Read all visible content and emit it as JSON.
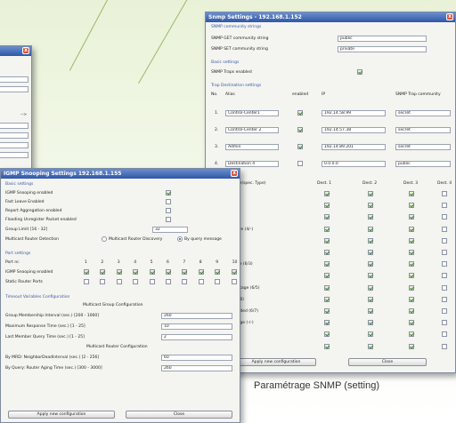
{
  "snmp": {
    "title": "Snmp Settings - 192.168.1.152",
    "community_section": "SNMP community strings",
    "get_label": "SNMP GET community string",
    "get_value": "public",
    "set_label": "SNMP SET community string",
    "set_value": "private",
    "basic_section": "Basic settings",
    "traps_label": "SNMP Traps enabled",
    "traps_enabled": true,
    "dest_section": "Trap Destination settings",
    "dest_headers": [
      "No.",
      "Alias",
      "enabled",
      "IP",
      "SNMP Trap community"
    ],
    "destinations": [
      {
        "no": "1.",
        "alias": "Control-Center1",
        "enabled": true,
        "ip": "192.14.58.99",
        "community": "secret"
      },
      {
        "no": "2.",
        "alias": "Control-Center 2",
        "enabled": true,
        "ip": "192.14.57.38",
        "community": "secret"
      },
      {
        "no": "3.",
        "alias": "Admin",
        "enabled": true,
        "ip": "192.14.89.201",
        "community": "secret"
      },
      {
        "no": "4.",
        "alias": "Destination 4",
        "enabled": false,
        "ip": "0.0.0.0",
        "community": "public"
      }
    ],
    "type_headers": [
      "Type(spec. Type)",
      "Dest. 1",
      "Dest. 2",
      "Dest. 3",
      "Dest. 4"
    ],
    "types": [
      {
        "label": "rt (0/-)",
        "checks": [
          true,
          true,
          true,
          false
        ]
      },
      {
        "label": "rt (1/-)",
        "checks": [
          true,
          true,
          true,
          false
        ]
      },
      {
        "label": "(2/-)",
        "checks": [
          true,
          true,
          true,
          false
        ]
      },
      {
        "label": "entication failure (4/-)",
        "checks": [
          true,
          true,
          true,
          false
        ]
      },
      {
        "label": "changes (6/5)",
        "checks": [
          true,
          true,
          true,
          false
        ]
      },
      {
        "label": "n reset (6/2)",
        "checks": [
          true,
          true,
          true,
          false
        ]
      },
      {
        "label": "channel Change (6/3)",
        "checks": [
          true,
          true,
          true,
          false
        ]
      },
      {
        "label": "ception (6/4)",
        "checks": [
          true,
          true,
          true,
          false
        ]
      },
      {
        "label": "n/Hardware voltage (6/5)",
        "checks": [
          true,
          true,
          true,
          false
        ]
      },
      {
        "label": "n Shutdown (6/6)",
        "checks": [
          true,
          true,
          true,
          false
        ]
      },
      {
        "label": "wer limit exceeded (6/7)",
        "checks": [
          true,
          true,
          true,
          false
        ]
      },
      {
        "label": "ink status change (-/-)",
        "checks": [
          true,
          true,
          true,
          false
        ]
      },
      {
        "label": "ng change (-/-)",
        "checks": [
          true,
          true,
          true,
          false
        ]
      },
      {
        "label": "n failure (6/10)",
        "checks": [
          true,
          true,
          true,
          false
        ]
      }
    ],
    "apply_label": "Apply new configuration",
    "close_label": "Close",
    "caption": "Paramétrage SNMP (setting)"
  },
  "igmp": {
    "title": "IGMP Snooping Settings 192.168.1.155",
    "basic_section": "Basic settings",
    "snooping_label": "IGMP Snooping enabled",
    "fastleave_label": "Fast Leave Enabled",
    "aggregation_label": "Report Aggregation enabled",
    "flooding_label": "Flooding Unregister Packet enabled",
    "group_limit_label": "Group Limit [16 - 32]",
    "group_limit_value": "32",
    "detection_label": "Multicast Router Detection",
    "detection_opt1": "Multicast Router Discovery",
    "detection_opt2": "By query message",
    "port_section": "Port settings",
    "port_label": "Port nr.",
    "ports": [
      "1",
      "2",
      "3",
      "4",
      "5",
      "6",
      "7",
      "8",
      "9",
      "10"
    ],
    "port_snoop_label": "IGMP Snooping enabled",
    "static_label": "Static Router Ports",
    "timeout_section": "Timeout Variables Configuration",
    "mgc_heading": "Multicast Group Configuration",
    "membership_label": "Group Membership Interval (sec.) [200 - 1000]",
    "membership_value": "260",
    "response_label": "Maximum Response Time (sec.) [1 - 25]",
    "response_value": "10",
    "lastmember_label": "Last Member Query Time (sec.) [1 - 25]",
    "lastmember_value": "2",
    "mrc_heading": "Multicast Router Configuration",
    "mrd_label": "By MRD: NeighborDeadInterval (sec.) [2 - 256]",
    "mrd_value": "60",
    "query_label": "By Query: Router Aging Time (sec.) [300 - 3000]",
    "query_value": "260",
    "apply_label": "Apply new configuration",
    "close_label": "Close"
  },
  "left_window": {
    "partial_text": "-->"
  }
}
